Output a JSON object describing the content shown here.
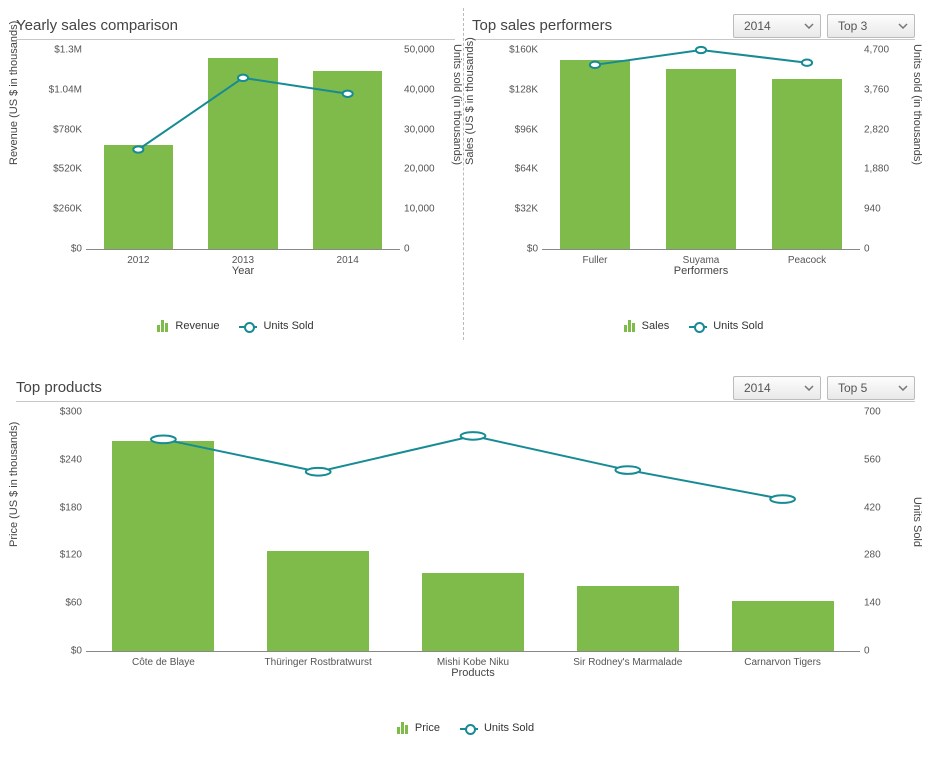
{
  "panels": {
    "yearly": {
      "title": "Yearly sales comparison",
      "xlabel": "Year",
      "ylabel_left": "Revenue (US $ in thousands)",
      "ylabel_right": "Units sold (in thousands)",
      "legend_bar": "Revenue",
      "legend_line": "Units Sold",
      "left_ticks": [
        "$0",
        "$260K",
        "$520K",
        "$780K",
        "$1.04M",
        "$1.3M"
      ],
      "right_ticks": [
        "0",
        "10,000",
        "20,000",
        "30,000",
        "40,000",
        "50,000"
      ],
      "categories": [
        "2012",
        "2013",
        "2014"
      ]
    },
    "performers": {
      "title": "Top sales performers",
      "dd_year": "2014",
      "dd_top": "Top 3",
      "xlabel": "Performers",
      "ylabel_left": "Sales (US $ in thousands)",
      "ylabel_right": "Units sold (in thousands)",
      "legend_bar": "Sales",
      "legend_line": "Units Sold",
      "left_ticks": [
        "$0",
        "$32K",
        "$64K",
        "$96K",
        "$128K",
        "$160K"
      ],
      "right_ticks": [
        "0",
        "940",
        "1,880",
        "2,820",
        "3,760",
        "4,700"
      ],
      "categories": [
        "Fuller",
        "Suyama",
        "Peacock"
      ]
    },
    "products": {
      "title": "Top products",
      "dd_year": "2014",
      "dd_top": "Top 5",
      "xlabel": "Products",
      "ylabel_left": "Price (US $ in thousands)",
      "ylabel_right": "Units Sold",
      "legend_bar": "Price",
      "legend_line": "Units Sold",
      "left_ticks": [
        "$0",
        "$60",
        "$120",
        "$180",
        "$240",
        "$300"
      ],
      "right_ticks": [
        "0",
        "140",
        "280",
        "420",
        "560",
        "700"
      ],
      "categories": [
        "Côte de Blaye",
        "Thüringer Rostbratwurst",
        "Mishi Kobe Niku",
        "Sir Rodney's Marmalade",
        "Carnarvon Tigers"
      ]
    }
  },
  "chart_data": [
    {
      "id": "yearly",
      "type": "bar+line",
      "title": "Yearly sales comparison",
      "xlabel": "Year",
      "categories": [
        "2012",
        "2013",
        "2014"
      ],
      "series": [
        {
          "name": "Revenue",
          "axis": "left",
          "type": "bar",
          "values": [
            680000,
            1250000,
            1160000
          ]
        },
        {
          "name": "Units Sold",
          "axis": "right",
          "type": "line",
          "values": [
            25000,
            43000,
            39000
          ]
        }
      ],
      "left_axis": {
        "label": "Revenue (US $ in thousands)",
        "min": 0,
        "max": 1300000,
        "ticks": [
          0,
          260000,
          520000,
          780000,
          1040000,
          1300000
        ]
      },
      "right_axis": {
        "label": "Units sold (in thousands)",
        "min": 0,
        "max": 50000,
        "ticks": [
          0,
          10000,
          20000,
          30000,
          40000,
          50000
        ]
      }
    },
    {
      "id": "performers",
      "type": "bar+line",
      "title": "Top sales performers",
      "xlabel": "Performers",
      "categories": [
        "Fuller",
        "Suyama",
        "Peacock"
      ],
      "series": [
        {
          "name": "Sales",
          "axis": "left",
          "type": "bar",
          "values": [
            152000,
            145000,
            137000
          ]
        },
        {
          "name": "Units Sold",
          "axis": "right",
          "type": "line",
          "values": [
            4350,
            4700,
            4400
          ]
        }
      ],
      "left_axis": {
        "label": "Sales (US $ in thousands)",
        "min": 0,
        "max": 160000,
        "ticks": [
          0,
          32000,
          64000,
          96000,
          128000,
          160000
        ]
      },
      "right_axis": {
        "label": "Units sold (in thousands)",
        "min": 0,
        "max": 4700,
        "ticks": [
          0,
          940,
          1880,
          2820,
          3760,
          4700
        ]
      }
    },
    {
      "id": "products",
      "type": "bar+line",
      "title": "Top products",
      "xlabel": "Products",
      "categories": [
        "Côte de Blaye",
        "Thüringer Rostbratwurst",
        "Mishi Kobe Niku",
        "Sir Rodney's Marmalade",
        "Carnarvon Tigers"
      ],
      "series": [
        {
          "name": "Price",
          "axis": "left",
          "type": "bar",
          "values": [
            264,
            125,
            98,
            82,
            63
          ]
        },
        {
          "name": "Units Sold",
          "axis": "right",
          "type": "line",
          "values": [
            620,
            525,
            630,
            530,
            445
          ]
        }
      ],
      "left_axis": {
        "label": "Price (US $ in thousands)",
        "min": 0,
        "max": 300,
        "ticks": [
          0,
          60,
          120,
          180,
          240,
          300
        ]
      },
      "right_axis": {
        "label": "Units Sold",
        "min": 0,
        "max": 700,
        "ticks": [
          0,
          140,
          280,
          420,
          560,
          700
        ]
      }
    }
  ]
}
